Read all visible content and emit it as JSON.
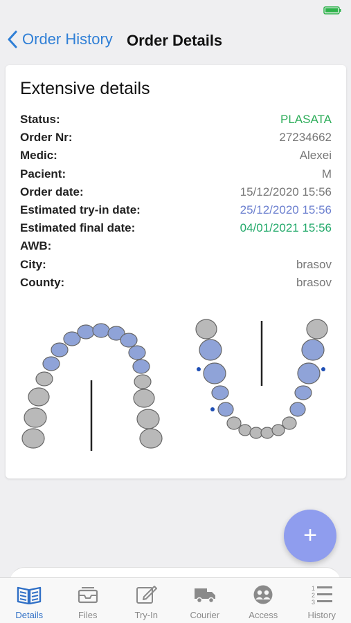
{
  "header": {
    "back_label": "Order History",
    "title": "Order Details"
  },
  "card": {
    "title": "Extensive details",
    "rows": [
      {
        "label": "Status:",
        "value": "PLASATA"
      },
      {
        "label": "Order Nr:",
        "value": "27234662"
      },
      {
        "label": "Medic:",
        "value": "Alexei"
      },
      {
        "label": "Pacient:",
        "value": "M"
      },
      {
        "label": "Order date:",
        "value": "15/12/2020 15:56"
      },
      {
        "label": "Estimated try-in date:",
        "value": "25/12/2020 15:56"
      },
      {
        "label": "Estimated final date:",
        "value": "04/01/2021 15:56"
      },
      {
        "label": "AWB:",
        "value": ""
      },
      {
        "label": "City:",
        "value": "brasov"
      },
      {
        "label": "County:",
        "value": "brasov"
      }
    ]
  },
  "fab": {
    "icon": "plus-icon",
    "label": "+"
  },
  "tabs": [
    {
      "label": "Details",
      "icon": "book-icon",
      "active": true
    },
    {
      "label": "Files",
      "icon": "tray-icon"
    },
    {
      "label": "Try-In",
      "icon": "edit-icon"
    },
    {
      "label": "Courier",
      "icon": "truck-icon"
    },
    {
      "label": "Access",
      "icon": "group-icon"
    },
    {
      "label": "History",
      "icon": "list-icon"
    }
  ],
  "colors": {
    "accent": "#2f7fd6",
    "status_green": "#2fae5b",
    "tryin_blue": "#6b7fcf",
    "final_green": "#22a96a",
    "fab": "#8f9dee",
    "tooth_selected": "#8fa3d8",
    "tooth_unselected": "#b9b9b9"
  }
}
